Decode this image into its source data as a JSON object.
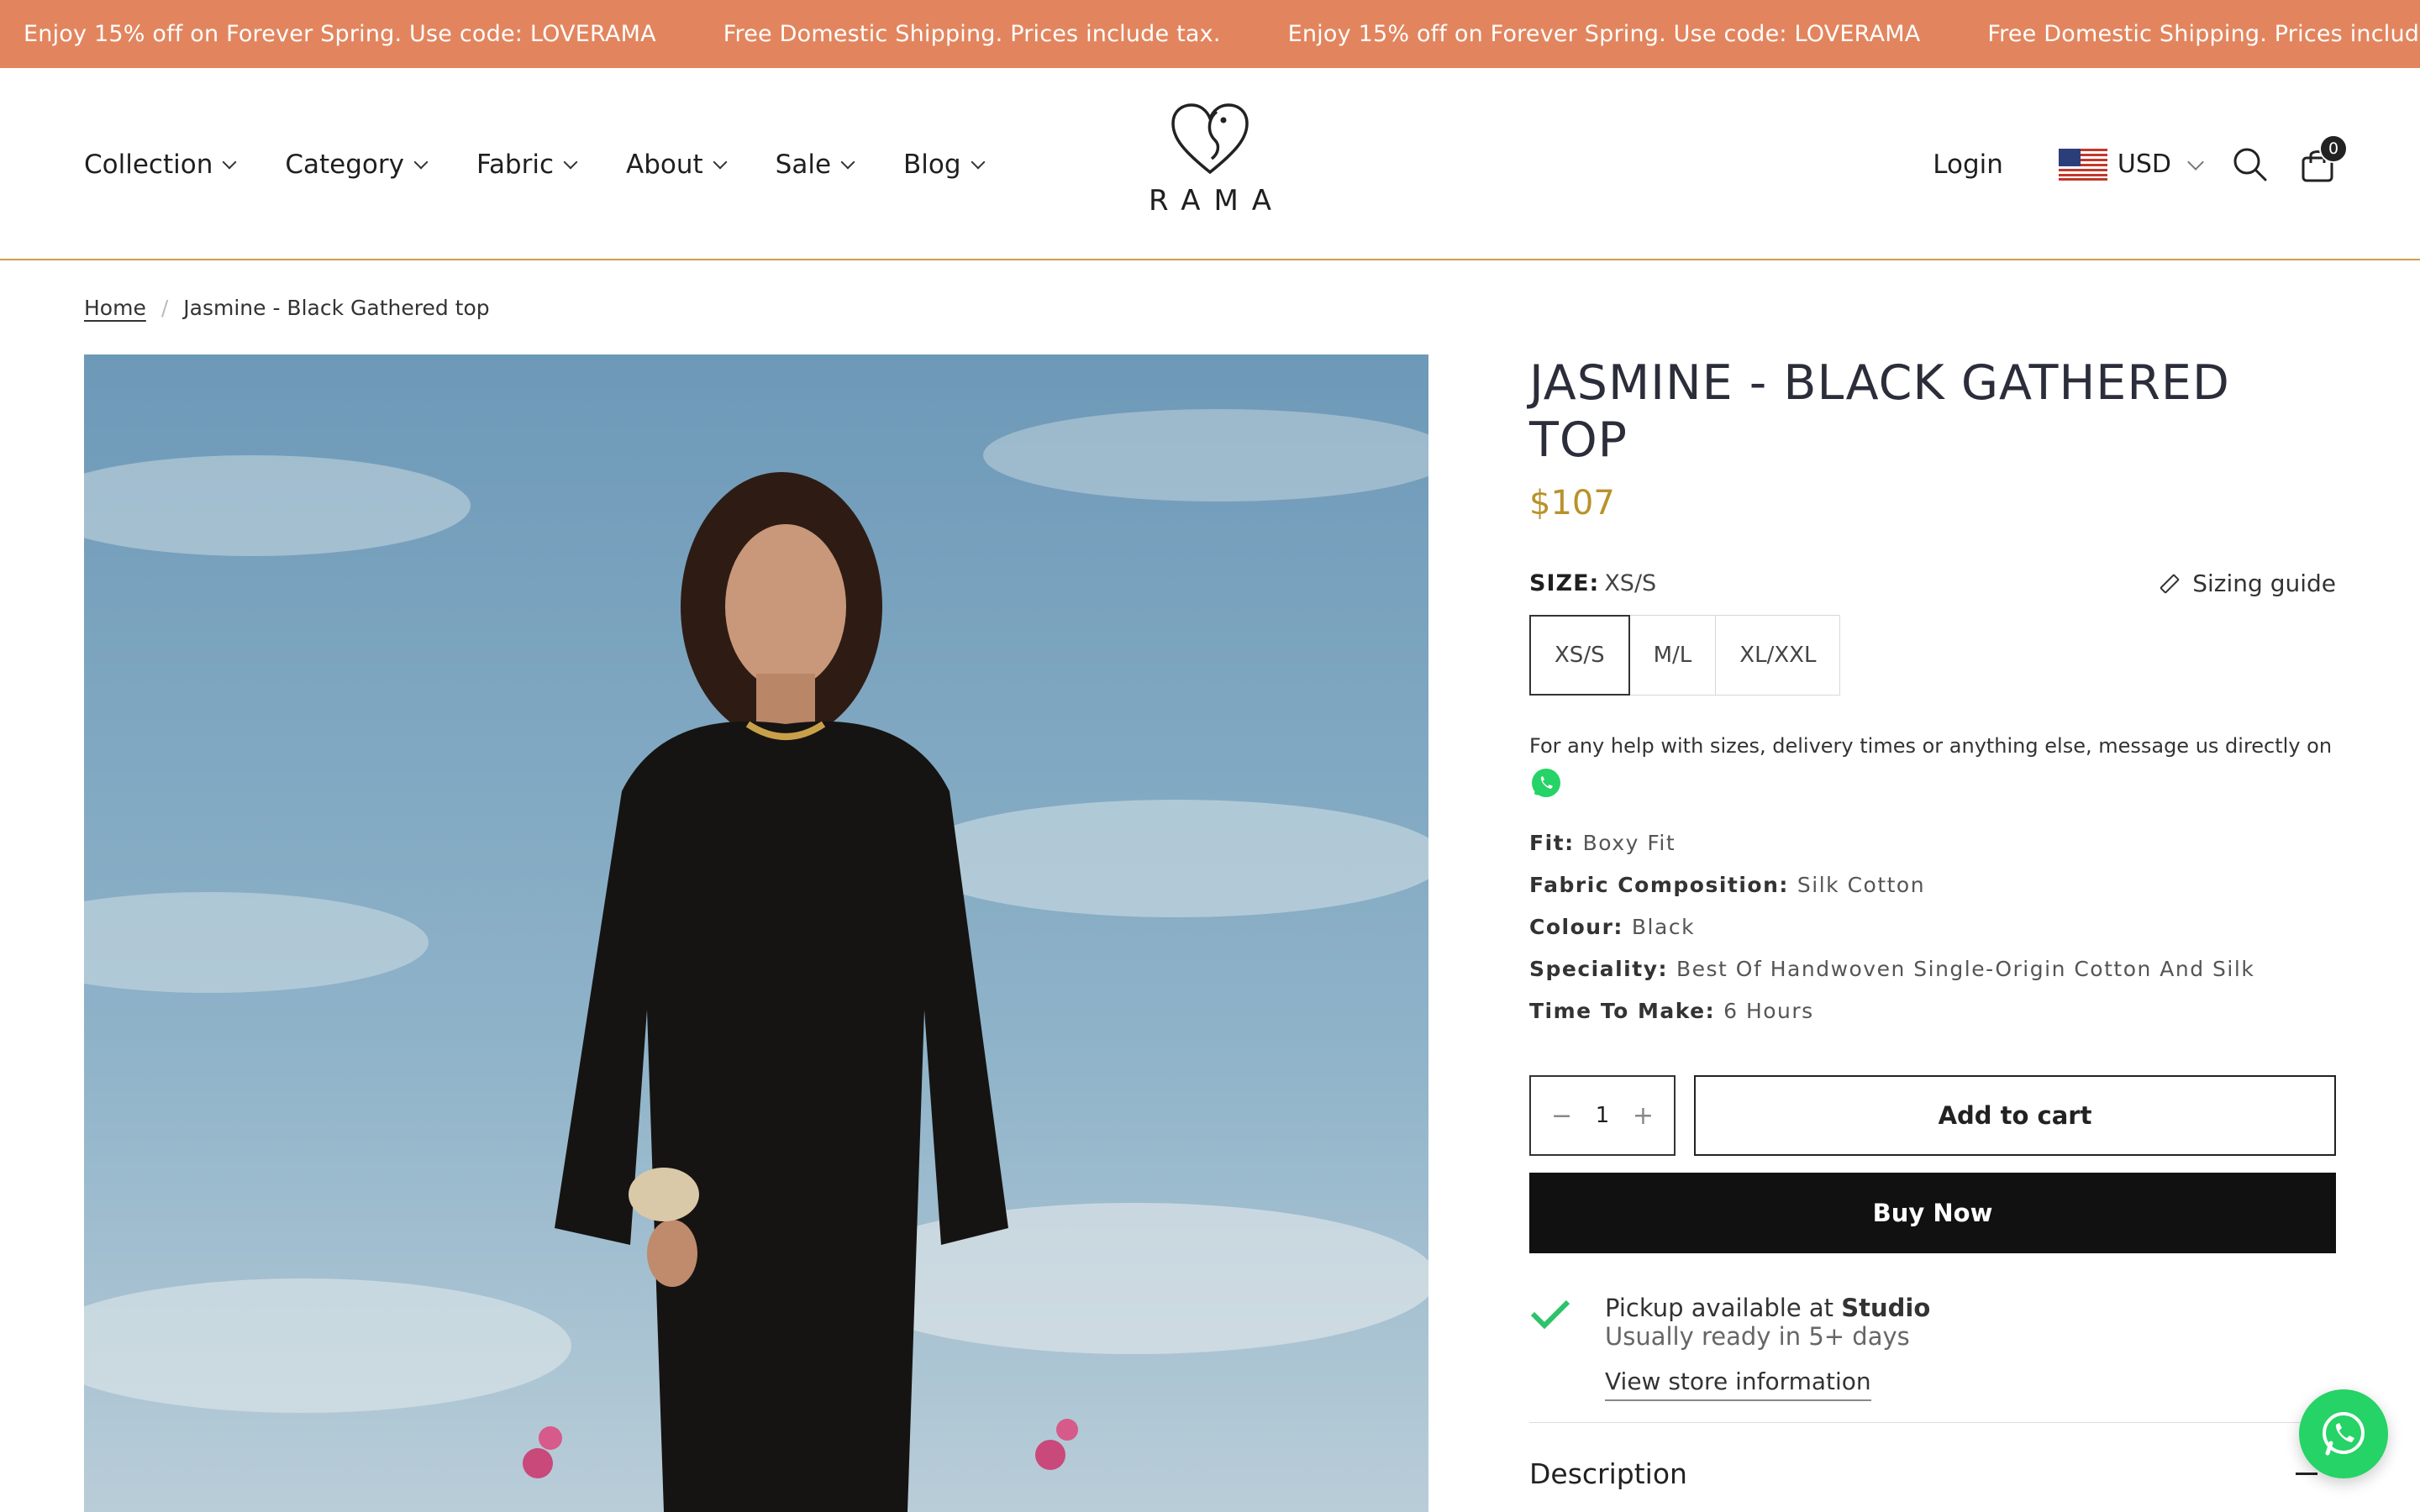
{
  "announcement": {
    "items": [
      "Enjoy 15% off on Forever Spring. Use code: LOVERAMA",
      "Free Domestic Shipping. Prices include tax.",
      "Enjoy 15% off on Forever Spring. Use code: LOVERAMA",
      "Free Domestic Shipping. Prices include tax."
    ],
    "bg_color": "#e2855e"
  },
  "nav": {
    "items": [
      {
        "label": "Collection"
      },
      {
        "label": "Category"
      },
      {
        "label": "Fabric"
      },
      {
        "label": "About"
      },
      {
        "label": "Sale"
      },
      {
        "label": "Blog"
      }
    ]
  },
  "brand": {
    "name": "RAMA"
  },
  "header": {
    "login_label": "Login",
    "currency": "USD",
    "cart_count": "0"
  },
  "breadcrumb": {
    "home": "Home",
    "separator": "/",
    "current": "Jasmine - Black Gathered top"
  },
  "product": {
    "title": "JASMINE - BLACK GATHERED TOP",
    "price": "$107",
    "price_color": "#b8922a",
    "size_label": "SIZE:",
    "size_selected": "XS/S",
    "sizing_guide": "Sizing guide",
    "sizes": [
      "XS/S",
      "M/L",
      "XL/XXL"
    ],
    "help_text": "For any help with sizes, delivery times or anything else, message us directly on",
    "specs": [
      {
        "key": "Fit:",
        "value": "Boxy Fit"
      },
      {
        "key": "Fabric Composition:",
        "value": "Silk Cotton"
      },
      {
        "key": "Colour:",
        "value": "Black"
      },
      {
        "key": "Speciality:",
        "value": "Best Of Handwoven Single-Origin Cotton And Silk"
      },
      {
        "key": "Time To Make:",
        "value": "6 Hours"
      }
    ],
    "quantity": "1",
    "qty_minus": "−",
    "qty_plus": "+",
    "add_to_cart": "Add to cart",
    "buy_now": "Buy Now"
  },
  "pickup": {
    "prefix": "Pickup available at",
    "location": "Studio",
    "sub": "Usually ready in 5+ days",
    "link": "View store information"
  },
  "description": {
    "label": "Description"
  },
  "icons": {
    "search": "search-icon",
    "cart": "cart-icon",
    "whatsapp": "whatsapp-icon",
    "ruler": "ruler-icon",
    "check": "check-icon"
  }
}
